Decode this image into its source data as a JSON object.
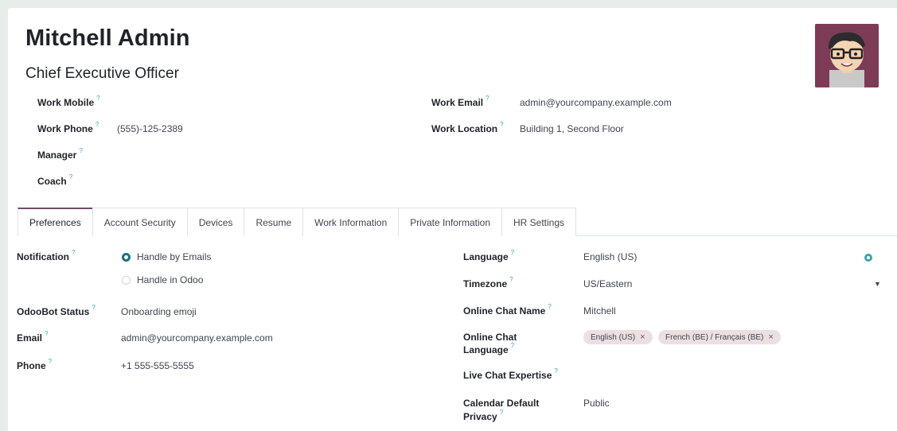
{
  "employee": {
    "name": "Mitchell Admin",
    "job_title": "Chief Executive Officer"
  },
  "left_fields": [
    {
      "label": "Work Mobile",
      "value": ""
    },
    {
      "label": "Work Phone",
      "value": "(555)-125-2389"
    },
    {
      "label": "Manager",
      "value": ""
    },
    {
      "label": "Coach",
      "value": ""
    }
  ],
  "right_fields": [
    {
      "label": "Work Email",
      "value": "admin@yourcompany.example.com"
    },
    {
      "label": "Work Location",
      "value": "Building 1, Second Floor"
    }
  ],
  "help_marker": "?",
  "tabs": [
    "Preferences",
    "Account Security",
    "Devices",
    "Resume",
    "Work Information",
    "Private Information",
    "HR Settings"
  ],
  "active_tab": "Preferences",
  "preferences": {
    "notification": {
      "label": "Notification",
      "options": [
        "Handle by Emails",
        "Handle in Odoo"
      ],
      "selected": "Handle by Emails"
    },
    "odoobot_status": {
      "label": "OdooBot Status",
      "value": "Onboarding emoji"
    },
    "email": {
      "label": "Email",
      "value": "admin@yourcompany.example.com"
    },
    "phone": {
      "label": "Phone",
      "value": "+1 555-555-5555"
    },
    "language": {
      "label": "Language",
      "value": "English (US)"
    },
    "timezone": {
      "label": "Timezone",
      "value": "US/Eastern"
    },
    "online_chat_name": {
      "label": "Online Chat Name",
      "value": "Mitchell"
    },
    "online_chat_language": {
      "label_line1": "Online Chat",
      "label_line2": "Language",
      "tags": [
        "English (US)",
        "French (BE) / Français (BE)"
      ]
    },
    "live_chat_expertise": {
      "label": "Live Chat Expertise",
      "value": ""
    },
    "calendar_privacy": {
      "label_line1": "Calendar Default",
      "label_line2": "Privacy",
      "value": "Public"
    }
  },
  "icons": {
    "language": "globe-icon",
    "timezone": "caret-down-icon",
    "tag_remove": "close-icon"
  },
  "colors": {
    "accent": "#714b67",
    "link": "#3aa3b3",
    "radio": "#1d6f86",
    "tag_bg": "#ecdfe2",
    "page_bg": "#e7eeea"
  }
}
